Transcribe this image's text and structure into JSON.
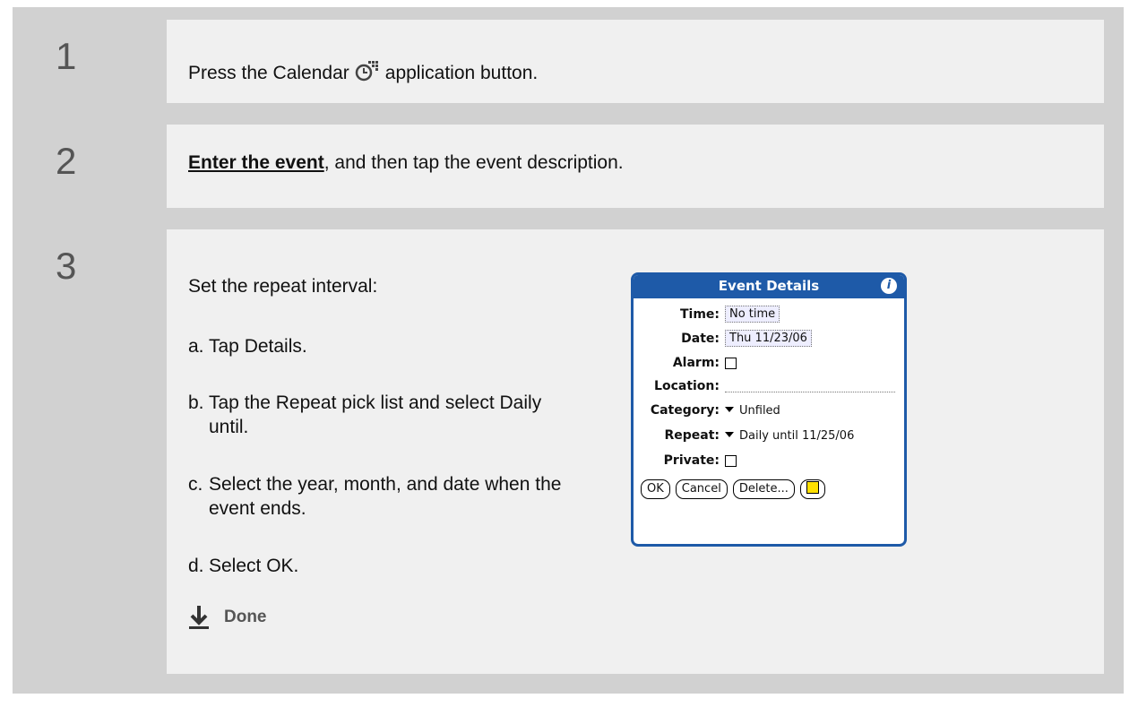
{
  "steps": [
    {
      "number": "1",
      "text_before": "Press the Calendar",
      "icon": "calendar-app-icon",
      "text_after": "application button."
    },
    {
      "number": "2",
      "link": "Enter the event",
      "text_after": ", and then tap the event description."
    },
    {
      "number": "3",
      "intro": "Set the repeat interval:",
      "items": [
        {
          "label": "a.",
          "text": "Tap Details."
        },
        {
          "label": "b.",
          "text": "Tap the Repeat pick list and select Daily until."
        },
        {
          "label": "c.",
          "text": "Select the year, month, and date when the event ends."
        },
        {
          "label": "d.",
          "text": "Select OK."
        }
      ],
      "done": "Done"
    }
  ],
  "dialog": {
    "title": "Event Details",
    "info_icon": "i",
    "time_label": "Time:",
    "time_value": "No time",
    "date_label": "Date:",
    "date_value": "Thu 11/23/06",
    "alarm_label": "Alarm:",
    "location_label": "Location:",
    "category_label": "Category:",
    "category_value": "Unfiled",
    "repeat_label": "Repeat:",
    "repeat_value": "Daily until 11/25/06",
    "private_label": "Private:",
    "buttons": {
      "ok": "OK",
      "cancel": "Cancel",
      "delete": "Delete..."
    }
  },
  "colors": {
    "frame": "#d1d1d1",
    "panel": "#f0f0f0",
    "dialog_accent": "#1e5aa8"
  }
}
